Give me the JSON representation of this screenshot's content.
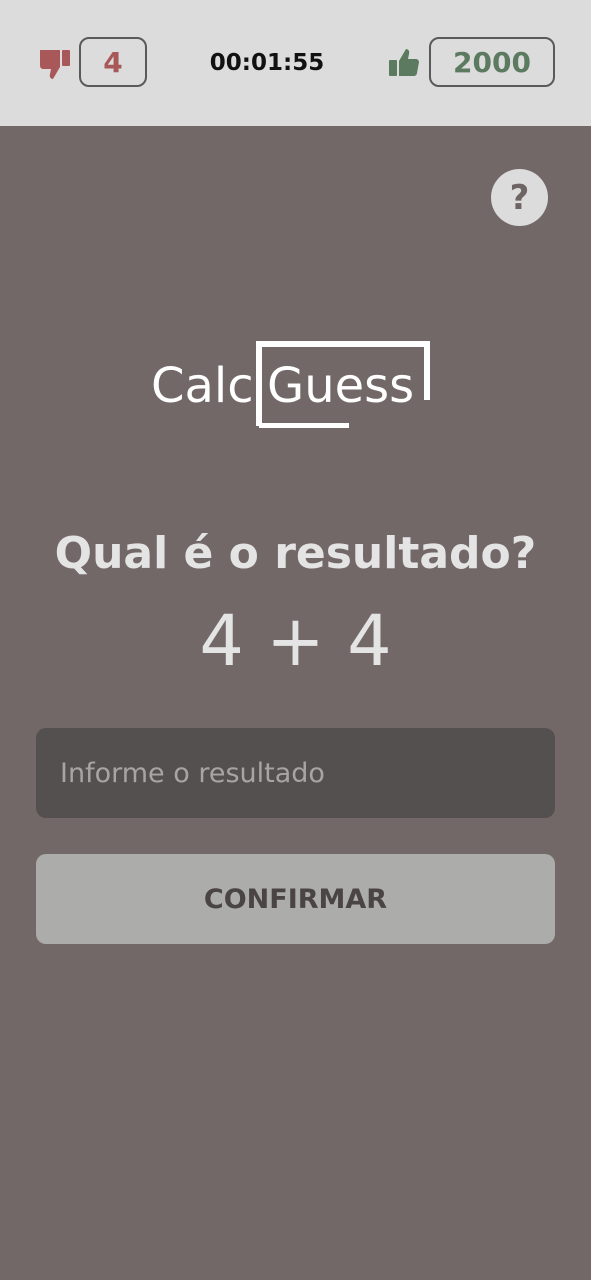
{
  "header": {
    "wrong_count": "4",
    "timer": "00:01:55",
    "score": "2000",
    "wrong_icon": "thumbs-down-icon",
    "score_icon": "thumbs-up-icon",
    "wrong_color": "#a85858",
    "score_color": "#5b7a5f"
  },
  "help": {
    "label": "?",
    "icon": "question-mark-icon"
  },
  "logo": {
    "part1": "Calc",
    "part2": "Guess"
  },
  "main": {
    "question": "Qual é o resultado?",
    "expression": "4 + 4"
  },
  "form": {
    "answer_placeholder": "Informe o resultado",
    "answer_value": "",
    "confirm_label": "CONFIRMAR"
  },
  "colors": {
    "background": "#736868",
    "topbar": "#dcdcdc",
    "input_bg": "#545050",
    "button_bg": "#acacaa"
  }
}
